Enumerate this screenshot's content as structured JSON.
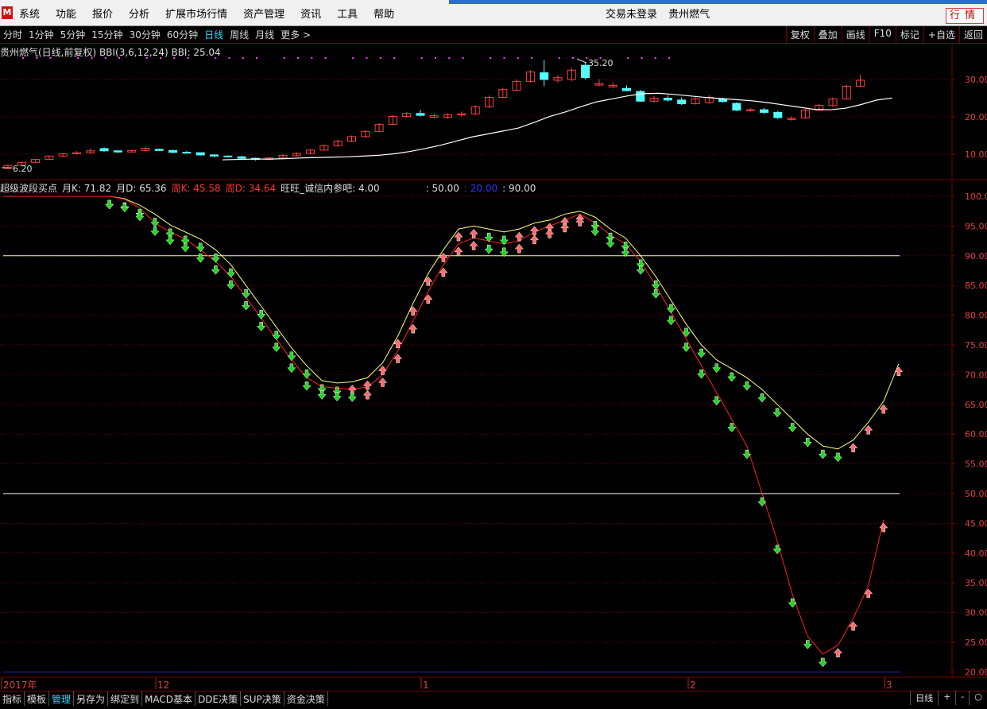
{
  "menu": {
    "logo": "M",
    "items": [
      "系统",
      "功能",
      "报价",
      "分析",
      "扩展市场行情",
      "资产管理",
      "资讯",
      "工具",
      "帮助"
    ],
    "login_status": "交易未登录",
    "stock_name": "贵州燃气",
    "quote_button": "行情"
  },
  "toolbar": {
    "periods": [
      "分时",
      "1分钟",
      "5分钟",
      "15分钟",
      "30分钟",
      "60分钟",
      "日线",
      "周线",
      "月线",
      "更多 >"
    ],
    "active_period": "日线",
    "actions": [
      "复权",
      "叠加",
      "画线",
      "F10",
      "标记",
      "+自选",
      "返回"
    ]
  },
  "main_panel": {
    "legend_title": "贵州燃气(日线,前复权)",
    "indicator": "BBI(3,6,12,24)",
    "indicator_value": "BBI: 25.04",
    "high_label": "35.20",
    "low_label": "6.20",
    "y_ticks": [
      "30.00",
      "20.00",
      "10.00"
    ]
  },
  "sub_panel": {
    "legend": [
      {
        "text": "超级波段买点",
        "color": "#dddddd"
      },
      {
        "text": "月K: 71.82",
        "color": "#dddddd"
      },
      {
        "text": "月D: 65.36",
        "color": "#dddddd"
      },
      {
        "text": "周K: 45.58",
        "color": "#ff3030"
      },
      {
        "text": "周D: 34.64",
        "color": "#ff3030"
      },
      {
        "text": "旺旺_诚信内参吧: 4.00",
        "color": "#dddddd"
      },
      {
        "text": ": 50.00",
        "color": "#dddddd"
      },
      {
        "text": ": 20.00",
        "color": "#3030ff"
      },
      {
        "text": ": 90.00",
        "color": "#dddddd"
      }
    ],
    "y_ticks": [
      "100.0",
      "95.00",
      "90.00",
      "85.00",
      "80.00",
      "75.00",
      "70.00",
      "65.00",
      "60.00",
      "55.00",
      "50.00",
      "45.00",
      "40.00",
      "35.00",
      "30.00",
      "25.00",
      "20.00"
    ]
  },
  "time_axis": {
    "labels": [
      "2017年",
      "12",
      "1",
      "2",
      "3"
    ]
  },
  "bottom_tabs": {
    "items": [
      "指标",
      "模板",
      "管理",
      "另存为",
      "绑定到",
      "MACD基本",
      "DDE决策",
      "SUP决策",
      "资金决策"
    ],
    "active": "管理",
    "right_label": "日线",
    "right_buttons": [
      "+",
      "-",
      "○"
    ]
  },
  "colors": {
    "up": "#ff4040",
    "down": "#54ffff",
    "bbi": "#ffffff",
    "monthly_line": "#ffff80",
    "weekly_line": "#ff2020",
    "buy_arrow": "#ff6a6a",
    "sell_arrow": "#1fd61f",
    "grid": "#7a0000",
    "active_blue": "#2fd9ff"
  },
  "chart_data": [
    {
      "type": "candlestick",
      "title": "贵州燃气(日线,前复权)",
      "series": [
        {
          "name": "BBI",
          "values": [
            8.5,
            8.6,
            8.7,
            8.7,
            8.8,
            9.0,
            9.1,
            9.2,
            9.3,
            9.5,
            9.7,
            10.1,
            10.7,
            11.5,
            12.4,
            13.5,
            14.6,
            15.4,
            16.2,
            17.0,
            18.5,
            20.1,
            21.3,
            22.7,
            24.0,
            24.8,
            25.6,
            26.2,
            26.3,
            26.0,
            25.6,
            25.2,
            24.9,
            24.6,
            24.3,
            23.8,
            23.2,
            22.6,
            22.0,
            21.9,
            22.3,
            23.3,
            24.5,
            25.04
          ]
        }
      ],
      "ohlc": [
        [
          6.2,
          7.0,
          6.2,
          7.2
        ],
        [
          7.0,
          7.8,
          6.9,
          8.0
        ],
        [
          7.8,
          8.6,
          7.7,
          8.8
        ],
        [
          8.6,
          9.5,
          8.5,
          9.7
        ],
        [
          9.5,
          10.1,
          9.3,
          10.3
        ],
        [
          10.1,
          10.4,
          9.9,
          10.8
        ],
        [
          10.4,
          10.9,
          10.1,
          11.6
        ],
        [
          11.5,
          10.9,
          10.7,
          11.8
        ],
        [
          10.9,
          10.6,
          10.3,
          11.0
        ],
        [
          10.6,
          11.0,
          10.4,
          11.2
        ],
        [
          11.0,
          11.6,
          10.9,
          11.9
        ],
        [
          11.3,
          11.0,
          10.9,
          11.5
        ],
        [
          11.0,
          10.5,
          10.3,
          11.2
        ],
        [
          10.5,
          10.4,
          10.2,
          10.9
        ],
        [
          10.4,
          9.8,
          9.6,
          10.4
        ],
        [
          9.8,
          9.5,
          9.2,
          10.0
        ],
        [
          9.5,
          9.3,
          9.1,
          9.7
        ],
        [
          9.3,
          8.9,
          8.7,
          9.6
        ],
        [
          8.9,
          8.6,
          8.3,
          9.1
        ],
        [
          8.6,
          9.0,
          8.5,
          9.3
        ],
        [
          9.0,
          9.7,
          8.9,
          10.0
        ],
        [
          9.6,
          10.2,
          9.4,
          10.5
        ],
        [
          10.2,
          11.1,
          10.0,
          11.4
        ],
        [
          11.1,
          12.3,
          10.9,
          12.6
        ],
        [
          12.3,
          13.5,
          12.1,
          13.9
        ],
        [
          13.5,
          14.7,
          13.2,
          15.0
        ],
        [
          14.7,
          16.1,
          14.4,
          16.4
        ],
        [
          16.1,
          18.0,
          15.9,
          18.3
        ],
        [
          18.0,
          20.1,
          17.8,
          20.5
        ],
        [
          20.1,
          20.9,
          19.8,
          21.3
        ],
        [
          20.9,
          20.4,
          20.1,
          21.9
        ],
        [
          19.9,
          20.3,
          19.6,
          20.9
        ],
        [
          19.9,
          20.6,
          19.5,
          21.0
        ],
        [
          20.5,
          20.8,
          20.0,
          21.4
        ],
        [
          20.8,
          22.7,
          20.5,
          23.1
        ],
        [
          22.7,
          25.2,
          22.4,
          25.7
        ],
        [
          25.2,
          27.3,
          25.0,
          27.8
        ],
        [
          27.1,
          29.5,
          26.9,
          30.0
        ],
        [
          29.5,
          32.0,
          29.2,
          32.5
        ],
        [
          31.8,
          30.0,
          28.3,
          35.2
        ],
        [
          29.8,
          30.5,
          29.1,
          31.2
        ],
        [
          30.0,
          32.5,
          29.6,
          33.2
        ],
        [
          33.8,
          30.5,
          30.0,
          34.5
        ],
        [
          28.5,
          28.9,
          28.2,
          30.1
        ],
        [
          28.0,
          28.4,
          27.8,
          29.2
        ],
        [
          27.6,
          27.0,
          26.8,
          28.4
        ],
        [
          26.8,
          24.2,
          24.0,
          27.2
        ],
        [
          24.2,
          25.0,
          23.8,
          25.6
        ],
        [
          25.0,
          24.5,
          24.1,
          25.8
        ],
        [
          24.5,
          23.5,
          23.2,
          25.2
        ],
        [
          23.5,
          24.8,
          23.3,
          25.4
        ],
        [
          23.8,
          25.2,
          23.5,
          25.8
        ],
        [
          24.7,
          24.1,
          23.8,
          25.1
        ],
        [
          23.6,
          21.8,
          21.5,
          23.9
        ],
        [
          21.8,
          21.9,
          21.4,
          22.4
        ],
        [
          21.9,
          21.2,
          20.8,
          22.4
        ],
        [
          21.2,
          19.8,
          19.4,
          21.6
        ],
        [
          19.3,
          19.6,
          19.0,
          20.1
        ],
        [
          19.7,
          21.8,
          19.5,
          22.1
        ],
        [
          21.8,
          23.1,
          21.6,
          23.4
        ],
        [
          23.0,
          24.8,
          22.8,
          25.2
        ],
        [
          24.8,
          28.2,
          24.6,
          28.6
        ],
        [
          28.2,
          29.8,
          28.0,
          31.2
        ]
      ]
    },
    {
      "type": "line",
      "title": "超级波段买点",
      "ylim": [
        20,
        100
      ],
      "series": [
        {
          "name": "月K",
          "values": [
            100,
            100,
            100,
            100,
            100,
            100,
            100,
            100,
            99.6,
            98.5,
            97.0,
            95.2,
            94.0,
            92.8,
            91.0,
            88.5,
            85.0,
            81.5,
            78.0,
            74.5,
            71.5,
            69.0,
            68.6,
            68.8,
            69.5,
            72.0,
            76.5,
            82.0,
            87.0,
            91.0,
            94.5,
            95.0,
            94.5,
            94.0,
            94.5,
            95.5,
            96.0,
            97.0,
            97.5,
            96.5,
            94.5,
            93.0,
            90.0,
            86.5,
            82.5,
            78.5,
            75.0,
            72.5,
            71.0,
            69.5,
            67.5,
            65.0,
            62.5,
            60.0,
            58.0,
            57.5,
            59.0,
            62.0,
            65.5,
            71.82
          ]
        },
        {
          "name": "周K",
          "values": [
            100,
            100,
            100,
            100,
            100,
            100,
            100,
            100,
            99.5,
            98.0,
            95.5,
            94.0,
            92.8,
            91.0,
            89.0,
            86.5,
            83.0,
            79.5,
            76.0,
            72.5,
            69.5,
            68.0,
            67.7,
            67.6,
            67.9,
            70.0,
            74.0,
            79.0,
            84.0,
            88.5,
            92.0,
            93.0,
            92.5,
            92.0,
            92.5,
            94.0,
            95.0,
            96.0,
            97.0,
            95.5,
            93.5,
            92.0,
            89.0,
            85.0,
            80.5,
            76.0,
            71.5,
            67.0,
            62.5,
            58.0,
            50.0,
            42.0,
            33.0,
            26.0,
            23.0,
            24.5,
            29.0,
            34.5,
            45.58
          ]
        }
      ],
      "reference_lines": [
        90.0,
        50.0,
        20.0
      ],
      "y_ticks": [
        100,
        95,
        90,
        85,
        80,
        75,
        70,
        65,
        60,
        55,
        50,
        45,
        40,
        35,
        30,
        25,
        20
      ]
    }
  ]
}
